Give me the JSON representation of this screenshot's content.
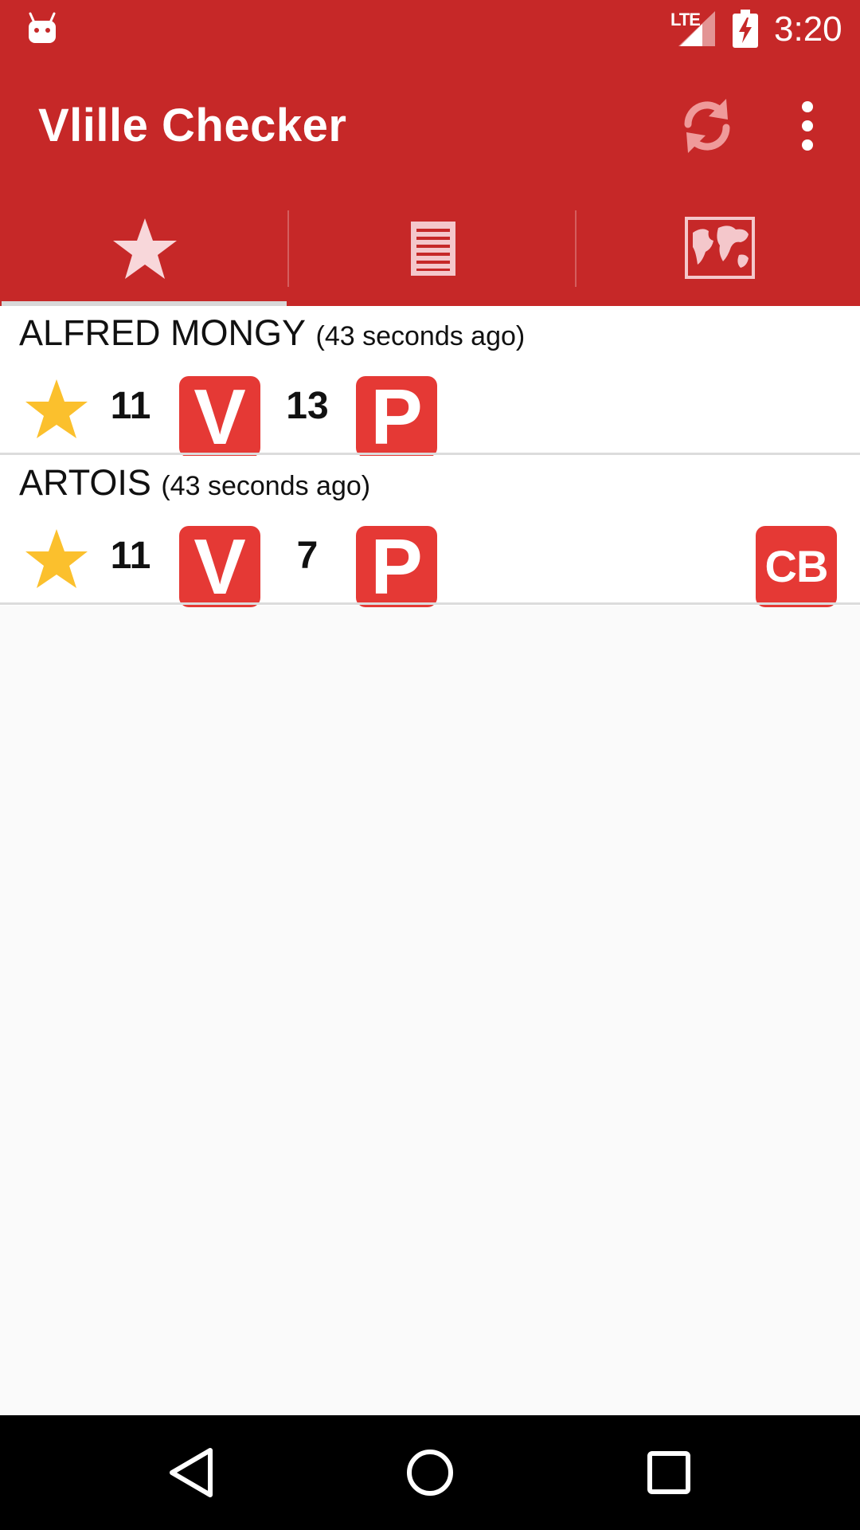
{
  "status_bar": {
    "network": "LTE",
    "time": "3:20"
  },
  "app_bar": {
    "title": "Vlille Checker",
    "icons": [
      "refresh-icon",
      "overflow-menu-icon"
    ]
  },
  "tabs": [
    {
      "icon": "star-icon",
      "selected": true
    },
    {
      "icon": "list-icon",
      "selected": false
    },
    {
      "icon": "world-map-icon",
      "selected": false
    }
  ],
  "stations": [
    {
      "name": "ALFRED MONGY",
      "updated": "(43 seconds ago)",
      "bikes": "11",
      "bikes_badge": "V",
      "slots": "13",
      "slots_badge": "P",
      "cb": ""
    },
    {
      "name": "ARTOIS",
      "updated": "(43 seconds ago)",
      "bikes": "11",
      "bikes_badge": "V",
      "slots": "7",
      "slots_badge": "P",
      "cb": "CB"
    }
  ],
  "colors": {
    "app_bar": "#c62828",
    "badge": "#e53935",
    "star": "#fbc02d",
    "background": "#fafafa"
  }
}
